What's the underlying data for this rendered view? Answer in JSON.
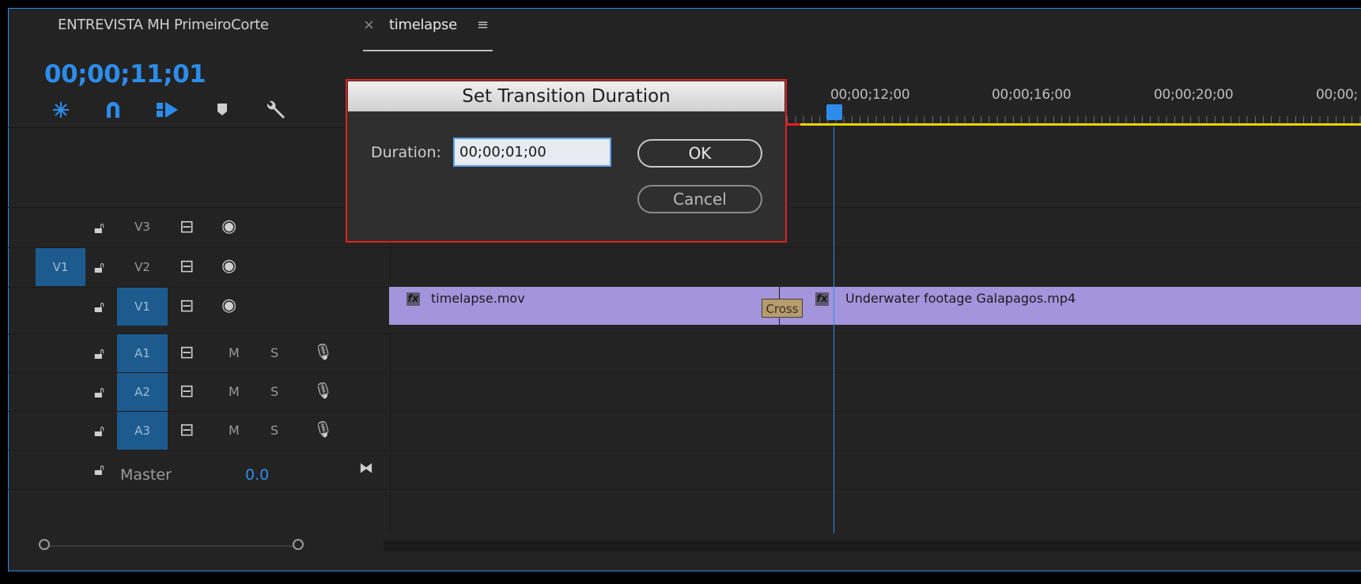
{
  "tabs": [
    {
      "label": "ENTREVISTA MH PrimeiroCorte"
    },
    {
      "close": "×",
      "label": "timelapse",
      "menu": "≡"
    }
  ],
  "timecode": "00;00;11;01",
  "tools": [
    "snap-icon",
    "linked-selection-icon",
    "insert-sequence-icon",
    "marker-icon",
    "wrench-icon"
  ],
  "ruler": [
    "00;00;12;00",
    "00;00;16;00",
    "00;00;20;00",
    "00;00;"
  ],
  "tracks": {
    "v3": {
      "label": "V3"
    },
    "v2": {
      "label": "V2",
      "source": "V1"
    },
    "v1": {
      "label": "V1"
    },
    "a1": {
      "label": "A1",
      "m": "M",
      "s": "S"
    },
    "a2": {
      "label": "A2",
      "m": "M",
      "s": "S"
    },
    "a3": {
      "label": "A3",
      "m": "M",
      "s": "S"
    },
    "master": {
      "label": "Master",
      "value": "0.0"
    }
  },
  "clips": {
    "clip1": {
      "fx": "fx",
      "name": "timelapse.mov"
    },
    "transition": {
      "name": "Cross"
    },
    "clip2": {
      "fx": "fx",
      "name": "Underwater footage Galapagos.mp4"
    }
  },
  "dialog": {
    "title": "Set Transition Duration",
    "label": "Duration:",
    "value": "00;00;01;00",
    "ok": "OK",
    "cancel": "Cancel"
  },
  "colors": {
    "accent": "#2d8ceb",
    "clip": "#a394dc",
    "in_out": "#e6d400",
    "dialog_border": "#e02020"
  }
}
